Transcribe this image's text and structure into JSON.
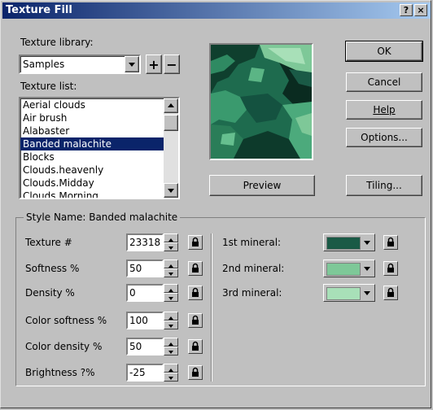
{
  "window": {
    "title": "Texture Fill",
    "help_button": "?",
    "close_button": "×"
  },
  "library": {
    "label": "Texture library:",
    "selected": "Samples",
    "add": "+",
    "remove": "−"
  },
  "texture_list": {
    "label": "Texture list:",
    "items": [
      "Aerial clouds",
      "Air brush",
      "Alabaster",
      "Banded malachite",
      "Blocks",
      "Clouds.heavenly",
      "Clouds.Midday",
      "Clouds.Morning"
    ],
    "selected_index": 3
  },
  "buttons": {
    "ok": "OK",
    "cancel": "Cancel",
    "help": "Help",
    "options": "Options...",
    "preview": "Preview",
    "tiling": "Tiling..."
  },
  "style": {
    "group_label": "Style Name: Banded malachite",
    "params": [
      {
        "label": "Texture #",
        "value": "23318"
      },
      {
        "label": "Softness %",
        "value": "50"
      },
      {
        "label": "Density %",
        "value": "0"
      },
      {
        "label": "Color softness %",
        "value": "100"
      },
      {
        "label": "Color density %",
        "value": "50"
      },
      {
        "label": "Brightness ?%",
        "value": "-25"
      }
    ],
    "minerals": [
      {
        "label": "1st mineral:",
        "color": "#1a5a46"
      },
      {
        "label": "2nd mineral:",
        "color": "#7ec898"
      },
      {
        "label": "3rd mineral:",
        "color": "#a8e0b8"
      }
    ]
  },
  "colors": {
    "title_start": "#0a246a",
    "title_end": "#a6caf0",
    "selection": "#0a246a"
  }
}
